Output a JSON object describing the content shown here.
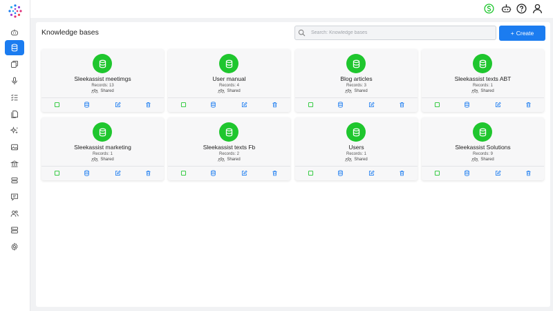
{
  "header": {
    "title": "Knowledge bases"
  },
  "search": {
    "placeholder": "Search: Knowledge bases"
  },
  "create_button": {
    "label": "Create"
  },
  "colors": {
    "accent": "#1b7cf0",
    "success": "#1fc62e",
    "edit": "#1b7cf0"
  },
  "sidebar": {
    "items": [
      {
        "icon": "robot-icon",
        "active": false
      },
      {
        "icon": "database-icon",
        "active": true
      },
      {
        "icon": "copy-icon",
        "active": false
      },
      {
        "icon": "microphone-icon",
        "active": false
      },
      {
        "icon": "list-icon",
        "active": false
      },
      {
        "icon": "documents-icon",
        "active": false
      },
      {
        "icon": "sparkles-icon",
        "active": false
      },
      {
        "icon": "image-icon",
        "active": false
      },
      {
        "icon": "bank-icon",
        "active": false
      },
      {
        "icon": "stack-icon",
        "active": false
      },
      {
        "icon": "chat-icon",
        "active": false
      },
      {
        "icon": "users-icon",
        "active": false
      },
      {
        "icon": "server-icon",
        "active": false
      },
      {
        "icon": "gear-icon",
        "active": false
      }
    ]
  },
  "topbar": {
    "icons": [
      "dollar-icon",
      "robot-icon",
      "help-icon",
      "user-icon"
    ]
  },
  "cards": [
    {
      "title": "Sleekassist meetimgs",
      "records": "Records: 13",
      "shared": "Shared"
    },
    {
      "title": "User manual",
      "records": "Records: 4",
      "shared": "Shared"
    },
    {
      "title": "Blog articles",
      "records": "Records: 3",
      "shared": "Shared"
    },
    {
      "title": "Sleekassist texts ABT",
      "records": "Records: 1",
      "shared": "Shared"
    },
    {
      "title": "Sleekassist marketing",
      "records": "Records: 1",
      "shared": "Shared"
    },
    {
      "title": "Sleekassist texts Fb",
      "records": "Records: 2",
      "shared": "Shared"
    },
    {
      "title": "Users",
      "records": "Records: 1",
      "shared": "Shared"
    },
    {
      "title": "Sleekassist Solutions",
      "records": "Records: 9",
      "shared": "Shared"
    }
  ]
}
